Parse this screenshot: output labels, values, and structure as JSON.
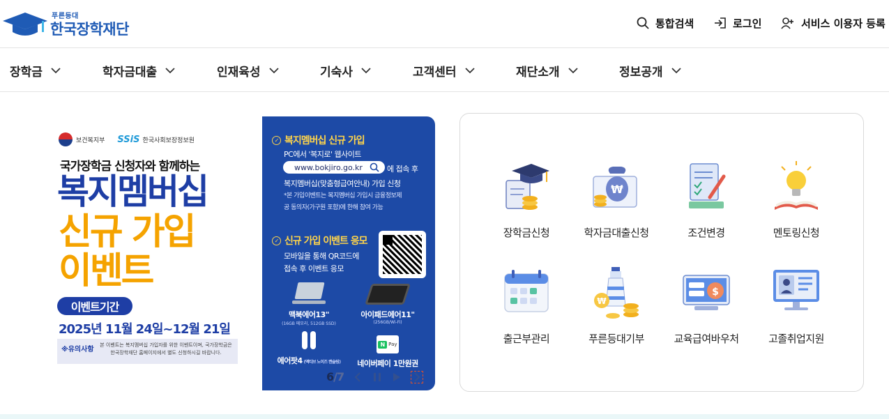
{
  "logo": {
    "sub": "푸른등대",
    "main": "한국장학재단"
  },
  "utility": [
    {
      "label": "통합검색",
      "icon": "search-icon"
    },
    {
      "label": "로그인",
      "icon": "login-icon"
    },
    {
      "label": "서비스 이용자 등록",
      "icon": "user-add-icon"
    }
  ],
  "gnb": [
    {
      "label": "장학금"
    },
    {
      "label": "학자금대출"
    },
    {
      "label": "인재육성"
    },
    {
      "label": "기숙사"
    },
    {
      "label": "고객센터"
    },
    {
      "label": "재단소개"
    },
    {
      "label": "정보공개"
    }
  ],
  "banner": {
    "org1": "보건복지부",
    "org2_mark": "SSiS",
    "org2": "한국사회보장정보원",
    "intro": "국가장학금 신청자와 함께하는",
    "headline1": "복지멤버십",
    "headline2": "신규 가입",
    "headline3": "이벤트",
    "period_tag": "이벤트기간",
    "period": "2025년 11월 24일~12월 21일",
    "notice_title": "※유의사항",
    "notice_text": "본 이벤트는 복지멤버십 가입자를 위한 이벤트이며, 국가장학금은 한국장학재단 홈페이지에서 별도 신청하시길 바랍니다.",
    "step1_title": "복지멤버십 신규 가입",
    "step1_line1": "PC에서 '복지로' 웹사이트",
    "step1_url": "www.bokjiro.go.kr",
    "step1_line2": "에 접속 후",
    "step1_line3": "복지멤버십(맞춤형급여안내) 가입 신청",
    "step1_note": "*본 가입이벤트는 복지멤버십 가입시 금융정보제공 동의자(가구원 포함)에 한해 참여 가능",
    "step2_title": "신규 가입 이벤트 응모",
    "step2_line1": "모바일을 통해 QR코드에",
    "step2_line2": "접속 후 이벤트 응모",
    "prizes": [
      {
        "name": "맥북에어13\"",
        "spec": "(16GB 메모리, 512GB SSD)"
      },
      {
        "name": "아이패드에어11\"",
        "spec": "(256GB/Wi-Fi)"
      },
      {
        "name": "에어팟4",
        "spec": "(액티브 노이즈 캔슬링)"
      },
      {
        "name": "네이버페이 1만원권",
        "spec": ""
      }
    ],
    "npay_mark": "N",
    "npay_text": "Pay",
    "pager_current": "6",
    "pager_total": "/7"
  },
  "quick_menu": [
    {
      "label": "장학금신청",
      "icon": "graduation-cap-icon"
    },
    {
      "label": "학자금대출신청",
      "icon": "money-bag-icon"
    },
    {
      "label": "조건변경",
      "icon": "document-edit-icon"
    },
    {
      "label": "멘토링신청",
      "icon": "lightbulb-book-icon"
    },
    {
      "label": "출근부관리",
      "icon": "calendar-icon"
    },
    {
      "label": "푸른등대기부",
      "icon": "lighthouse-coin-icon"
    },
    {
      "label": "교육급여바우처",
      "icon": "voucher-icon"
    },
    {
      "label": "고졸취업지원",
      "icon": "monitor-profile-icon"
    }
  ],
  "colors": {
    "brand": "#1f5bb5",
    "banner_blue": "#1d4aa6",
    "accent_yellow": "#f5a300"
  }
}
